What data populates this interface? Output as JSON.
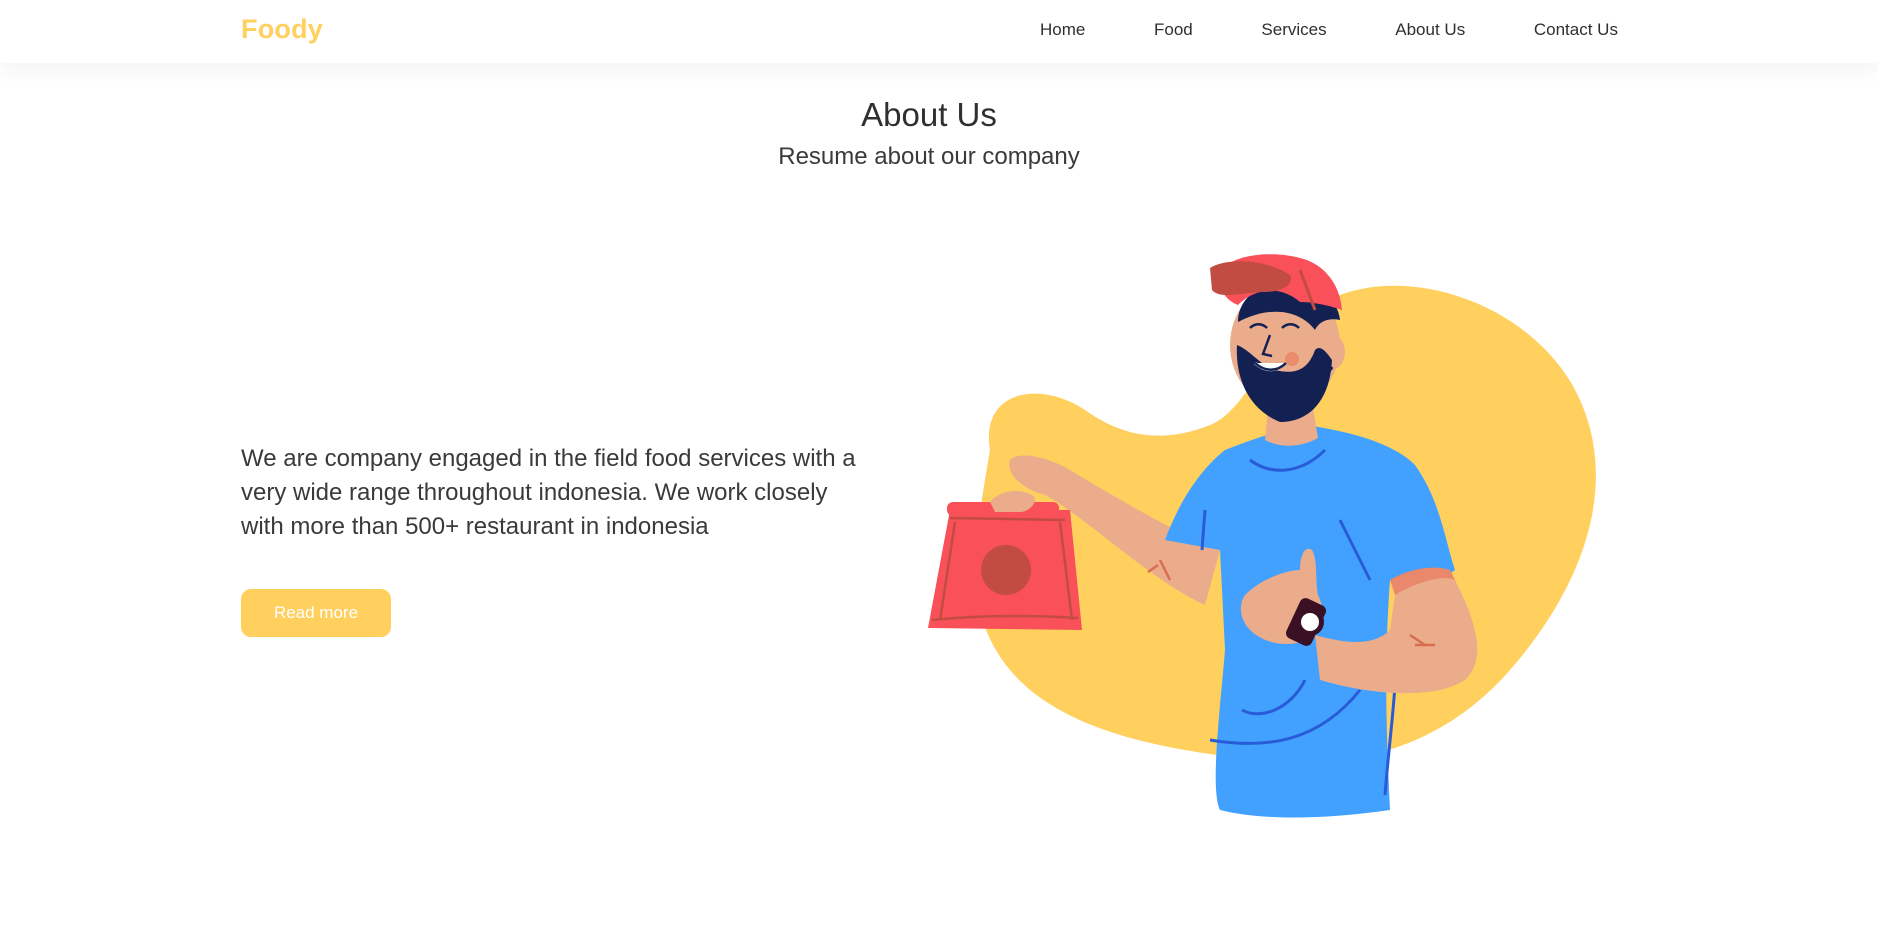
{
  "navbar": {
    "brand": "Foody",
    "links": [
      "Home",
      "Food",
      "Services",
      "About Us",
      "Contact Us"
    ]
  },
  "section": {
    "title": "About Us",
    "subtitle": "Resume about our company"
  },
  "about": {
    "text": "We are company engaged in the field food services with a very wide range throughout indonesia. We work closely with more than 500+ restaurant in indonesia",
    "button_label": "Read more"
  },
  "colors": {
    "accent": "#ffd05e",
    "text": "#333333",
    "shirt": "#42a0ff",
    "cap": "#f95059",
    "skin": "#eaac8b",
    "beard": "#132152"
  }
}
